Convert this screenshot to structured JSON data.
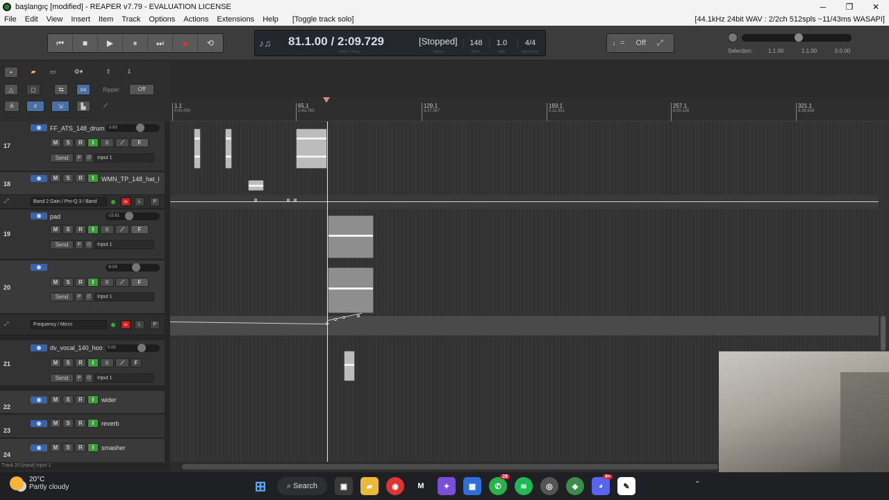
{
  "window": {
    "title": "başlangıç [modified] - REAPER v7.79 - EVALUATION LICENSE",
    "controls": [
      "─",
      "❐",
      "✕"
    ]
  },
  "menu": {
    "items": [
      "File",
      "Edit",
      "View",
      "Insert",
      "Item",
      "Track",
      "Options",
      "Actions",
      "Extensions",
      "Help"
    ],
    "hint": "[Toggle track solo]",
    "audio_info": "[44.1kHz 24bit WAV : 2/2ch 512spls ~11/43ms WASAPI]"
  },
  "transport": {
    "position": "81.1.00 / 2:09.729",
    "position_sub": "bars / time",
    "status": "[Stopped]",
    "status_sub": "status",
    "bpm": "148",
    "bpm_sub": "bpm",
    "rate": "1.0",
    "rate_sub": "rate",
    "signature": "4/4",
    "signature_sub": "signature",
    "grid_value": "Off",
    "selection_label": "Selection:",
    "selection_start": "1.1.00",
    "selection_end": "1.1.00",
    "selection_length": "0.0.00"
  },
  "toolbar": {
    "ripple_label": "Ripple:",
    "ripple_value": "Off"
  },
  "ruler": [
    {
      "bar": "1.1",
      "time": "0:00.000"
    },
    {
      "bar": "65.1",
      "time": "1:43.783"
    },
    {
      "bar": "129.1",
      "time": "3:27.567"
    },
    {
      "bar": "193.1",
      "time": "5:11.351"
    },
    {
      "bar": "257.1",
      "time": "6:55.135"
    },
    {
      "bar": "321.1",
      "time": "8:38.918"
    }
  ],
  "tracks": [
    {
      "num": "17",
      "name": "FF_ATS_148_drum",
      "vol": "-3.63",
      "send": "Send",
      "input": "Input 1"
    },
    {
      "num": "18",
      "name": "WMN_TP_148_hat_l"
    },
    {
      "num": "19",
      "name": "pad",
      "vol": "-15.61",
      "send": "Send",
      "input": "Input 1"
    },
    {
      "num": "20",
      "name": "",
      "vol": "-6.04",
      "send": "Send",
      "input": "Input 1"
    },
    {
      "num": "21",
      "name": "dv_vocal_140_hoo",
      "vol": "0.00",
      "send": "Send",
      "input": "Input 1"
    },
    {
      "num": "22",
      "name": "wider"
    },
    {
      "num": "23",
      "name": "reverb"
    },
    {
      "num": "24",
      "name": "smasher"
    }
  ],
  "buttons": {
    "m": "M",
    "s": "S",
    "r": "R",
    "i": "I",
    "f": "F",
    "p": "P",
    "phase": "∅"
  },
  "envelopes": [
    {
      "param": "Band 2 Gain / Pro-Q 3 / Band",
      "l": "L",
      "p": "P"
    },
    {
      "param": "Frequency / Micro",
      "l": "L",
      "p": "P"
    }
  ],
  "status_line": "Track 20 [input] Input 1",
  "taskbar": {
    "temp": "20°C",
    "condition": "Partly cloudy",
    "search": "Search",
    "badge_whatsapp": "28",
    "badge_discord": "9+"
  }
}
